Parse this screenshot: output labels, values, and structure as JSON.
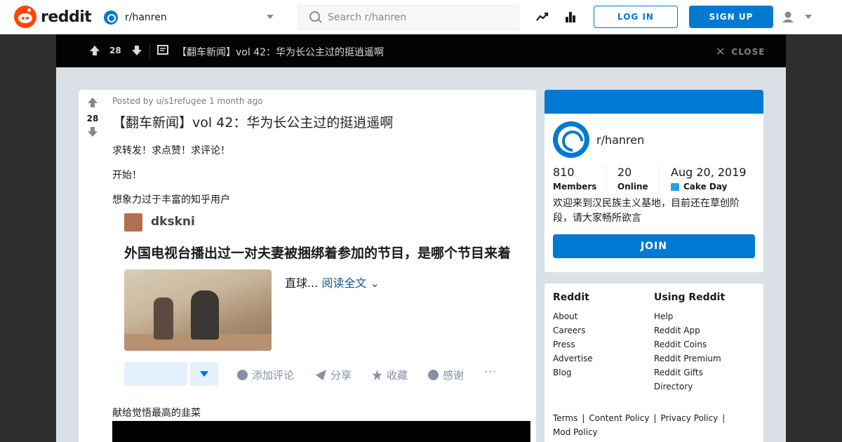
{
  "header": {
    "logo_text": "reddit",
    "subreddit": "r/hanren",
    "search_placeholder": "Search r/hanren",
    "login_label": "LOG IN",
    "signup_label": "SIGN UP"
  },
  "postbar": {
    "score": "28",
    "title": "【翻车新闻】vol 42：华为长公主过的挺逍遥啊",
    "close_label": "CLOSE"
  },
  "post": {
    "score": "28",
    "meta": "Posted by u/s1refugee 1 month ago",
    "title": "【翻车新闻】vol 42：华为长公主过的挺逍遥啊",
    "paragraphs": [
      "求转发！求点赞！求评论！",
      "开始！",
      "想象力过于丰富的知乎用户"
    ],
    "embed": {
      "username": "dkskni",
      "question": "外国电视台播出过一对夫妻被捆绑着参加的节目，是哪个节目来着",
      "excerpt": "直球...",
      "read_more": "阅读全文",
      "actions": [
        "添加评论",
        "分享",
        "收藏",
        "感谢"
      ],
      "dots": "···"
    },
    "caption": "献给觉悟最高的韭菜"
  },
  "community": {
    "name": "r/hanren",
    "members": "810",
    "members_label": "Members",
    "online": "20",
    "online_label": "Online",
    "cake_date": "Aug 20, 2019",
    "cake_label": "Cake Day",
    "description": "欢迎来到汉民族主义基地，目前还在草创阶段，请大家畅所欲言",
    "join_label": "JOIN"
  },
  "footer": {
    "col1_title": "Reddit",
    "col1_links": [
      "About",
      "Careers",
      "Press",
      "Advertise",
      "Blog"
    ],
    "col2_title": "Using Reddit",
    "col2_links": [
      "Help",
      "Reddit App",
      "Reddit Coins",
      "Reddit Premium",
      "Reddit Gifts",
      "Directory"
    ],
    "bottom_links": [
      "Terms",
      "Content Policy",
      "Privacy Policy",
      "Mod Policy"
    ]
  },
  "colors": {
    "brand": "#ff4500",
    "accent": "#0079d3",
    "dark_bar": "#030303",
    "page_bg": "#dae0e6"
  }
}
